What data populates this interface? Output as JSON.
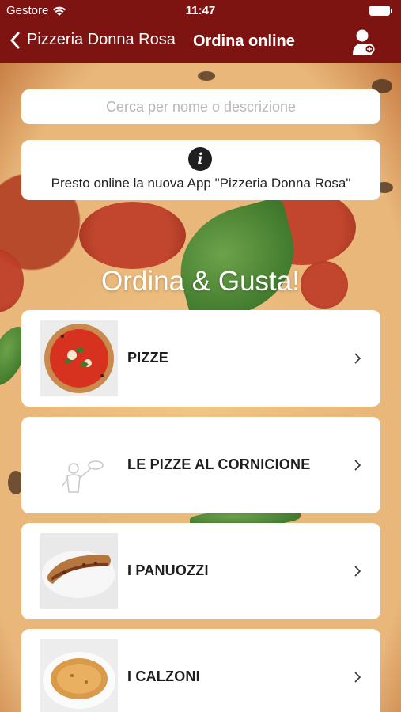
{
  "status_bar": {
    "carrier": "Gestore",
    "time": "11:47"
  },
  "nav": {
    "back_label": "Pizzeria Donna Rosa",
    "title": "Ordina online"
  },
  "search": {
    "placeholder": "Cerca per nome o descrizione"
  },
  "info": {
    "text": "Presto online la nuova App \"Pizzeria Donna Rosa\""
  },
  "slogan": "Ordina & Gusta!",
  "categories": [
    {
      "label": "PIZZE",
      "image": "pizza-photo"
    },
    {
      "label": "LE PIZZE AL CORNICIONE",
      "image": "pizza-chef-illustration"
    },
    {
      "label": "I PANUOZZI",
      "image": "panuozzo-photo"
    },
    {
      "label": "I CALZONI",
      "image": "calzone-photo"
    }
  ],
  "colors": {
    "brand": "#7d1411",
    "card": "#ffffff",
    "text": "#1e1e1e"
  }
}
